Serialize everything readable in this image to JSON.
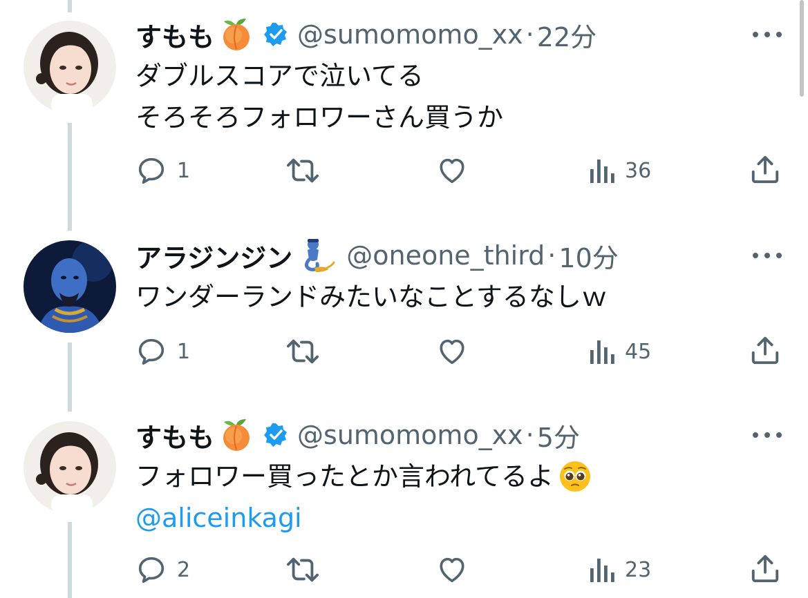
{
  "tweets": [
    {
      "name": "すもも",
      "handle": "@sumomomo_xx",
      "separator": "·",
      "time": "22分",
      "emoji_icon": "peach-emoji",
      "verified": true,
      "lines": [
        "ダブルスコアで泣いてる",
        "そろそろフォロワーさん買うか"
      ],
      "reply_count": "1",
      "retweet_count": "",
      "like_count": "",
      "view_count": "36"
    },
    {
      "name": "アラジンジン",
      "handle": "@oneone_third",
      "separator": "·",
      "time": "10分",
      "emoji_icon": "genie-emoji",
      "verified": false,
      "lines": [
        "ワンダーランドみたいなことするなしｗ"
      ],
      "reply_count": "1",
      "retweet_count": "",
      "like_count": "",
      "view_count": "45"
    },
    {
      "name": "すもも",
      "handle": "@sumomomo_xx",
      "separator": "·",
      "time": "5分",
      "emoji_icon": "peach-emoji",
      "verified": true,
      "lines": [
        "フォロワー買ったとか言われてるよ"
      ],
      "line_emoji": "pleading-face-emoji",
      "mention": "@aliceinkagi",
      "reply_count": "2",
      "retweet_count": "",
      "like_count": "",
      "view_count": "23"
    }
  ],
  "colors": {
    "text": "#0f1419",
    "secondary": "#536471",
    "accent": "#1d9bf0",
    "thread_line": "#cfd9de"
  }
}
